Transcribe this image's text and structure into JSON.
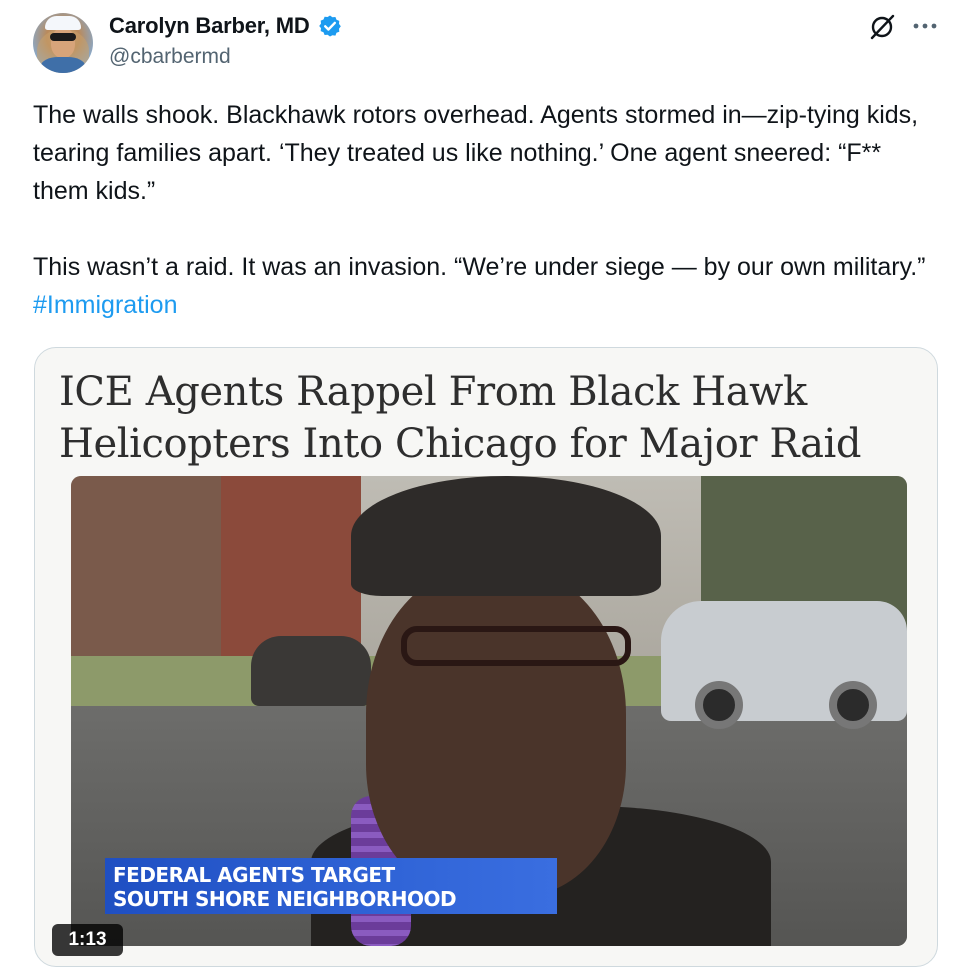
{
  "author": {
    "display_name": "Carolyn Barber, MD",
    "handle": "@cbarbermd",
    "verified": true
  },
  "tweet": {
    "paragraph1": "The walls shook. Blackhawk rotors overhead. Agents stormed in—zip-tying kids, tearing families apart. ‘They treated us like nothing.’ One agent sneered: “F** them kids.”",
    "paragraph2_text": "This wasn’t a raid. It was an invasion. “We’re under siege — by our own military.”",
    "hashtag": "#Immigration"
  },
  "media": {
    "headline_line1": "ICE Agents Rappel From Black Hawk",
    "headline_line2": "Helicopters Into Chicago for Major Raid",
    "chyron_line1": "FEDERAL AGENTS TARGET",
    "chyron_line2": "SOUTH SHORE NEIGHBORHOOD",
    "duration": "1:13"
  },
  "icons": {
    "verified": "verified-badge-icon",
    "grok": "grok-icon",
    "more": "more-options-icon"
  },
  "colors": {
    "link": "#1d9bf0",
    "verified": "#1d9bf0",
    "handle": "#536471",
    "text": "#0f1419"
  }
}
